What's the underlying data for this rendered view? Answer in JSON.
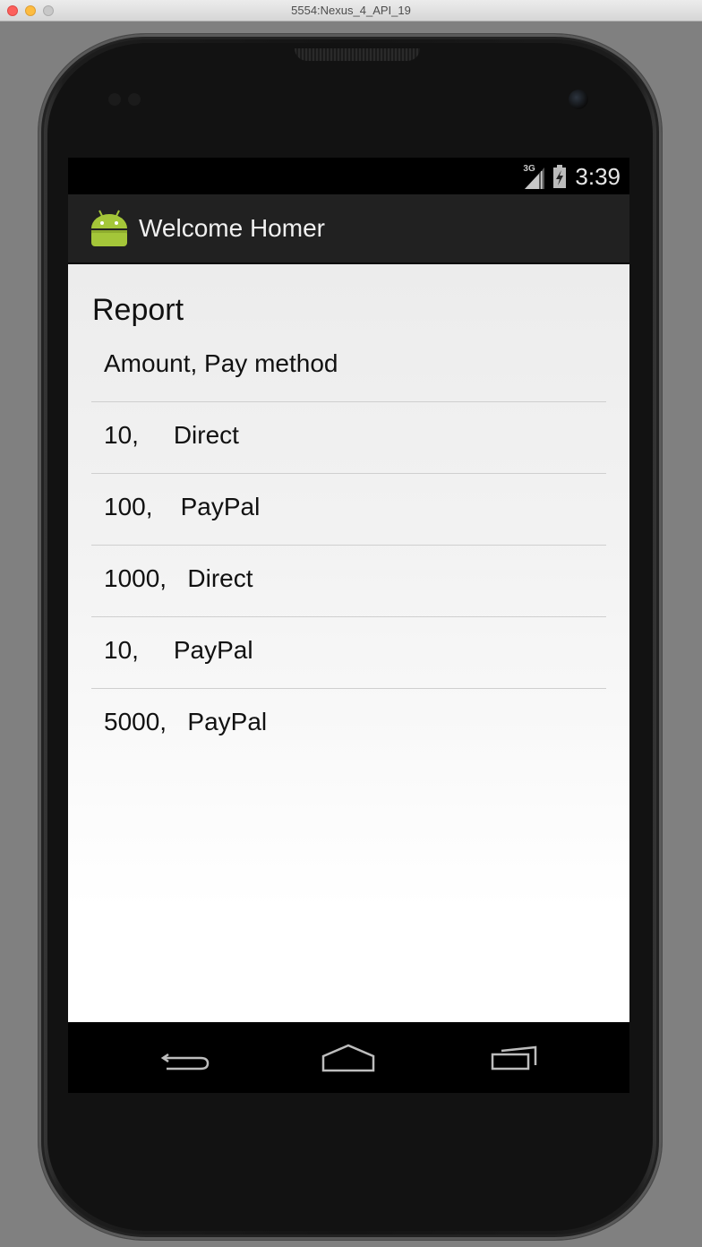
{
  "window": {
    "title": "5554:Nexus_4_API_19"
  },
  "status_bar": {
    "network": "3G",
    "time": "3:39"
  },
  "action_bar": {
    "title": "Welcome Homer",
    "app_icon": "android-robot-icon"
  },
  "report": {
    "heading": "Report",
    "rows": [
      "Amount, Pay method",
      "10,     Direct",
      "100,    PayPal",
      "1000,   Direct",
      "10,     PayPal",
      "5000,   PayPal"
    ]
  },
  "navigation": {
    "buttons": [
      "back-icon",
      "home-icon",
      "recents-icon"
    ]
  },
  "colors": {
    "action_bar": "#212121",
    "android_green": "#a4c639",
    "content_background": "#f0f0f0"
  }
}
